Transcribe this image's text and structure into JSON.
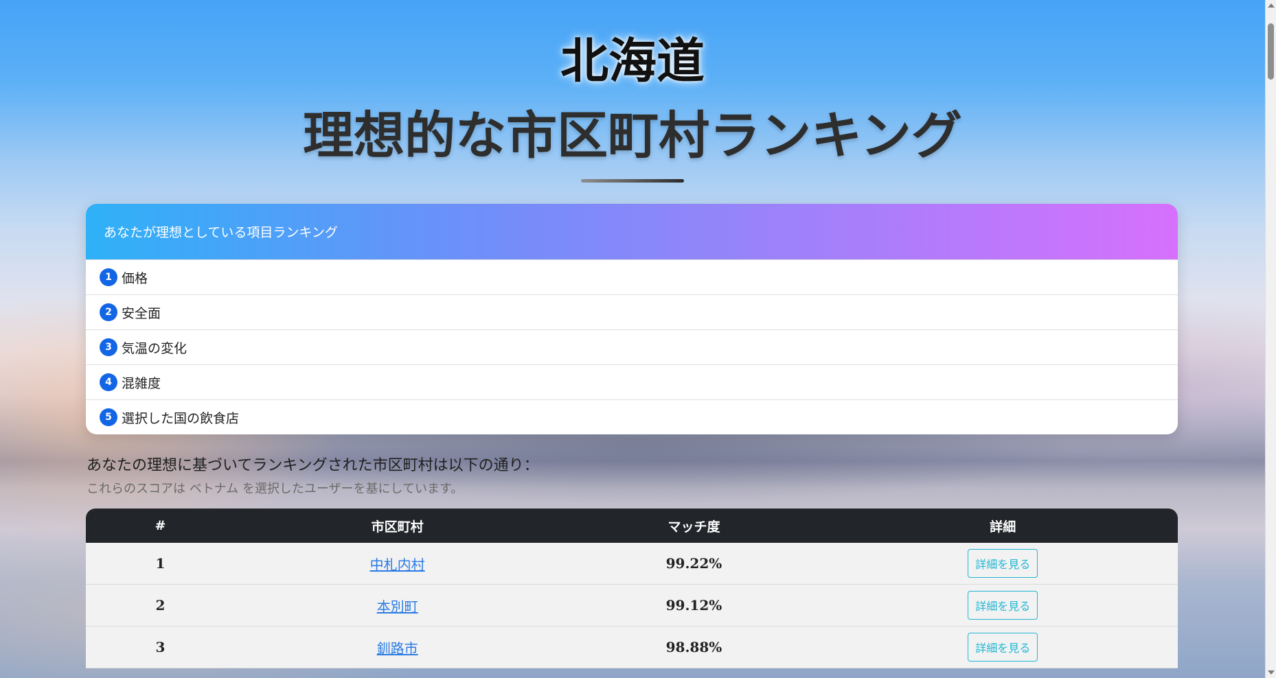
{
  "header": {
    "region": "北海道",
    "title": "理想的な市区町村ランキング"
  },
  "priorities": {
    "heading": "あなたが理想としている項目ランキング",
    "items": [
      {
        "rank": "1",
        "label": "価格"
      },
      {
        "rank": "2",
        "label": "安全面"
      },
      {
        "rank": "3",
        "label": "気温の変化"
      },
      {
        "rank": "4",
        "label": "混雑度"
      },
      {
        "rank": "5",
        "label": "選択した国の飲食店"
      }
    ]
  },
  "results": {
    "intro": "あなたの理想に基づいてランキングされた市区町村は以下の通り：",
    "note": "これらのスコアは ベトナム を選択したユーザーを基にしています。",
    "columns": {
      "rank": "#",
      "city": "市区町村",
      "match": "マッチ度",
      "detail": "詳細"
    },
    "rows": [
      {
        "rank": "1",
        "city": "中札内村",
        "match": "99.22%",
        "button": "詳細を見る"
      },
      {
        "rank": "2",
        "city": "本別町",
        "match": "99.12%",
        "button": "詳細を見る"
      },
      {
        "rank": "3",
        "city": "釧路市",
        "match": "98.88%",
        "button": "詳細を見る"
      }
    ]
  }
}
